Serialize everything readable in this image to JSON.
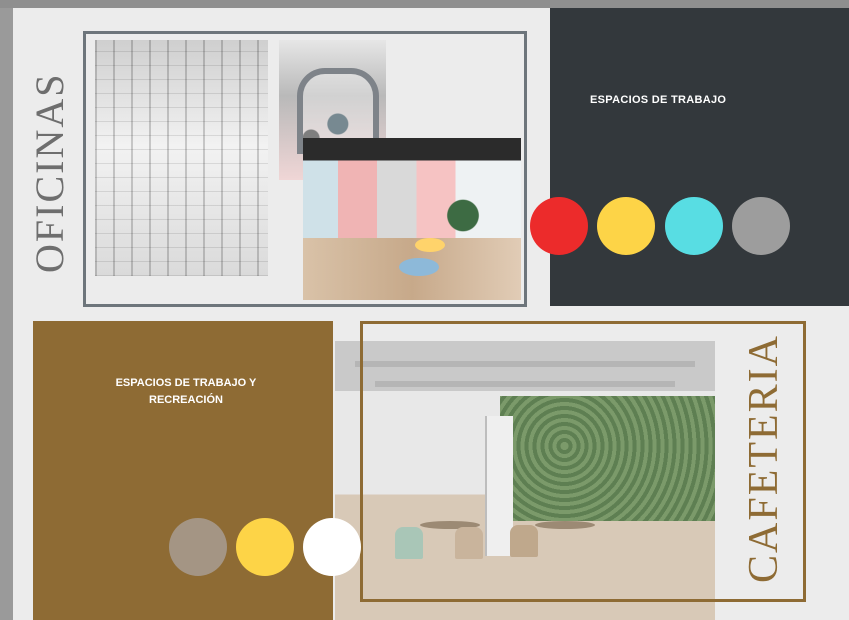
{
  "oficinas": {
    "title": "OFICINAS",
    "caption": "ESPACIOS DE TRABAJO",
    "palette": [
      "#ec2b2b",
      "#fdd447",
      "#58dde3",
      "#9d9d9d"
    ]
  },
  "cafeteria": {
    "title": "CAFETERIA",
    "caption": "ESPACIOS DE TRABAJO Y RECREACIÓN",
    "palette": [
      "#a49584",
      "#fdd447",
      "#ffffff"
    ]
  },
  "colors": {
    "dark_panel": "#33383c",
    "brown_panel": "#8e6b34",
    "frame_gray": "#6d757b"
  }
}
